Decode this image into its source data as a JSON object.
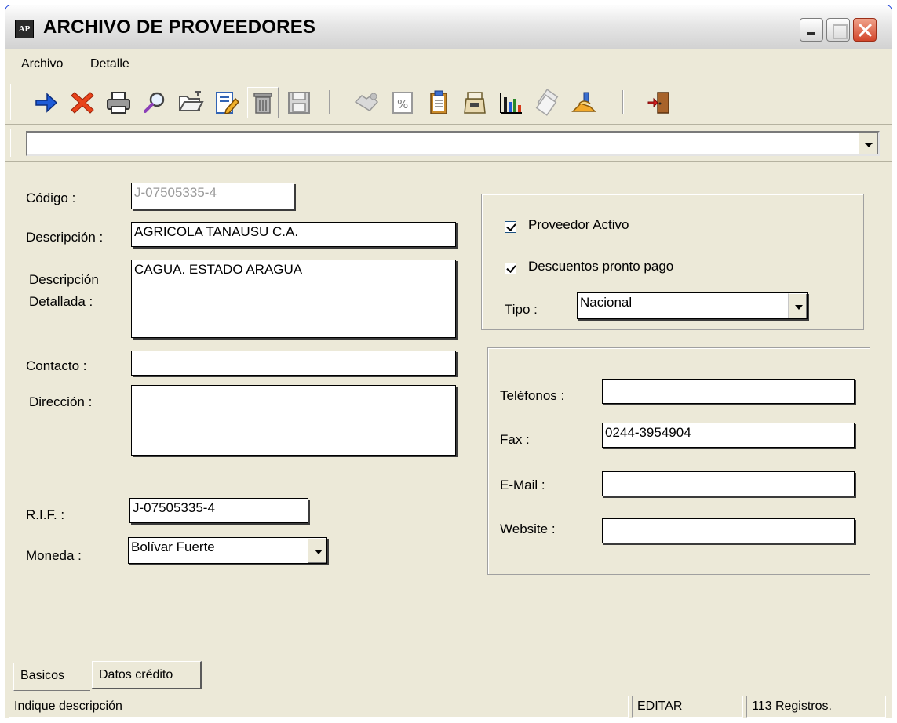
{
  "window": {
    "title": "ARCHIVO DE PROVEEDORES"
  },
  "menu": {
    "items": [
      "Archivo",
      "Detalle"
    ]
  },
  "toolbar": {
    "buttons": [
      {
        "icon": "arrow-right-icon"
      },
      {
        "icon": "delete-x-icon"
      },
      {
        "icon": "print-icon"
      },
      {
        "icon": "search-icon"
      },
      {
        "icon": "open-folder-icon"
      },
      {
        "icon": "edit-icon"
      },
      {
        "icon": "trash-icon"
      },
      {
        "icon": "save-icon"
      },
      {
        "icon": "handshake-icon"
      },
      {
        "icon": "percent-icon"
      },
      {
        "icon": "clipboard-icon"
      },
      {
        "icon": "cash-register-icon"
      },
      {
        "icon": "bar-chart-icon"
      },
      {
        "icon": "documents-icon"
      },
      {
        "icon": "hand-money-icon"
      },
      {
        "icon": "exit-door-icon"
      }
    ]
  },
  "record_selector": {
    "value": ""
  },
  "form": {
    "codigo_label": "Código :",
    "codigo_value": "J-07505335-4",
    "descripcion_label": "Descripción :",
    "descripcion_value": "AGRICOLA TANAUSU C.A.",
    "desc_detallada_label_1": "Descripción",
    "desc_detallada_label_2": "Detallada :",
    "desc_detallada_value": "CAGUA. ESTADO ARAGUA",
    "contacto_label": "Contacto :",
    "contacto_value": "",
    "direccion_label": "Dirección :",
    "direccion_value": "",
    "rif_label": "R.I.F. :",
    "rif_value": "J-07505335-4",
    "moneda_label": "Moneda :",
    "moneda_value": "Bolívar Fuerte",
    "proveedor_activo_label": "Proveedor Activo",
    "proveedor_activo_checked": true,
    "descuentos_label": "Descuentos pronto pago",
    "descuentos_checked": true,
    "tipo_label": "Tipo :",
    "tipo_value": "Nacional",
    "telefonos_label": "Teléfonos :",
    "telefonos_value": "",
    "fax_label": "Fax :",
    "fax_value": "0244-3954904",
    "email_label": "E-Mail :",
    "email_value": "",
    "website_label": "Website :",
    "website_value": ""
  },
  "tabs": [
    "Basicos",
    "Datos crédito"
  ],
  "status": {
    "message": "Indique descripción",
    "mode": "EDITAR",
    "records": "113 Registros."
  }
}
